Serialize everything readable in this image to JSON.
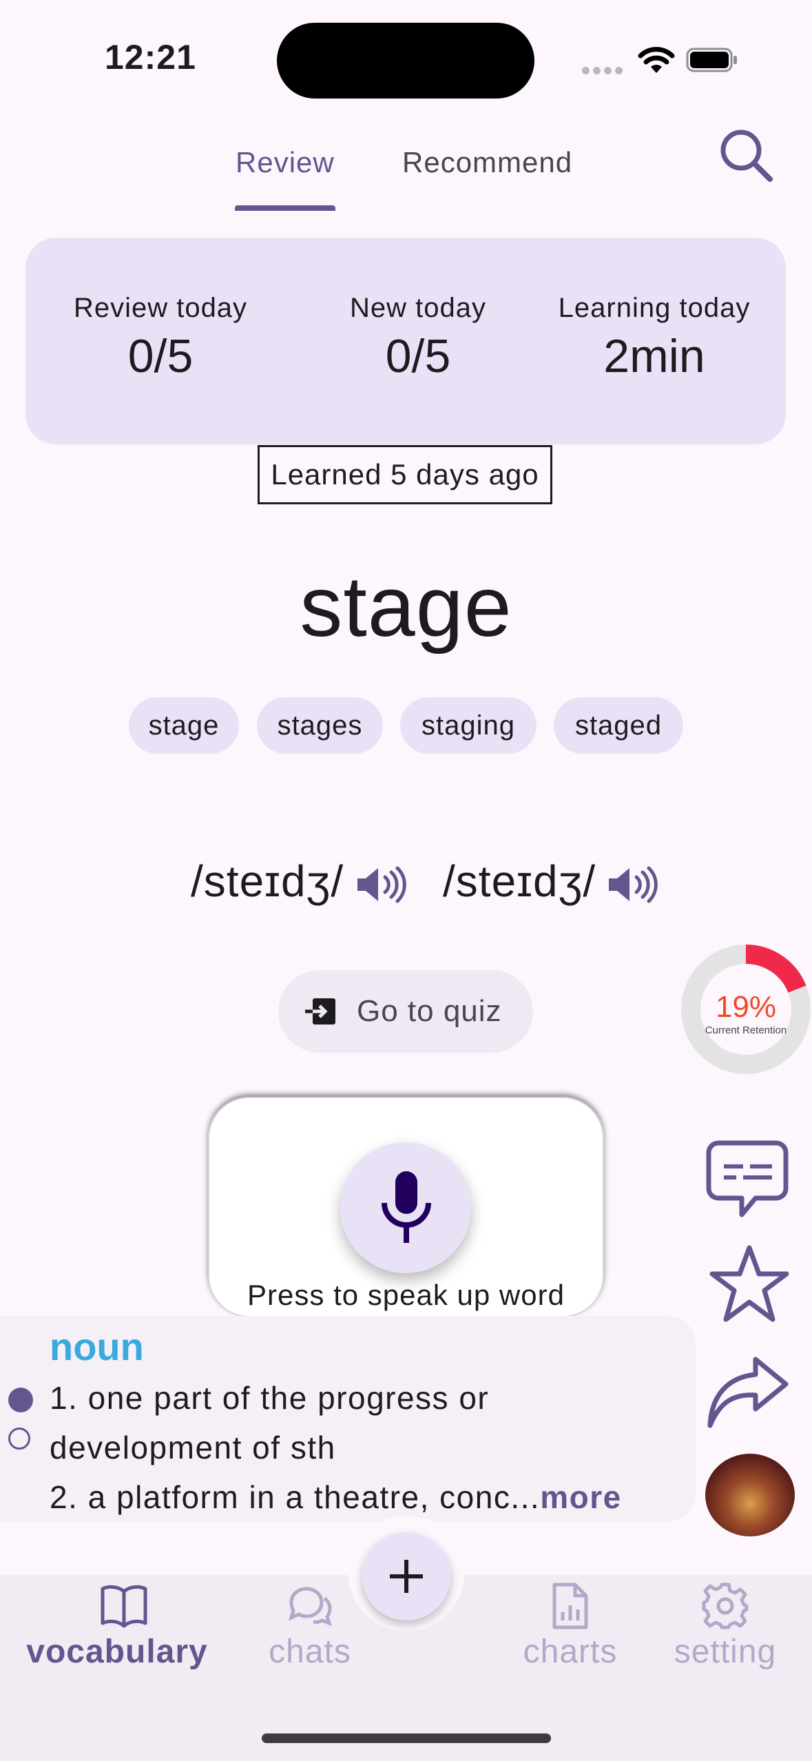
{
  "status_bar": {
    "time": "12:21"
  },
  "tabs": [
    {
      "label": "Review",
      "active": true
    },
    {
      "label": "Recommend",
      "active": false
    }
  ],
  "stats": [
    {
      "label": "Review today",
      "value": "0/5"
    },
    {
      "label": "New today",
      "value": "0/5"
    },
    {
      "label": "Learning today",
      "value": "2min"
    }
  ],
  "learned_badge": "Learned 5 days ago",
  "word": "stage",
  "forms": [
    "stage",
    "stages",
    "staging",
    "staged"
  ],
  "pronunciations": [
    "/steɪdʒ/",
    "/steɪdʒ/"
  ],
  "quiz_button": "Go to quiz",
  "retention": {
    "percent": "19%",
    "label": "Current Retention",
    "fraction": 0.19
  },
  "speak_hint": "Press to speak up word",
  "definition": {
    "part_of_speech": "noun",
    "line1": "1. one part of the progress or",
    "line2": "development of sth",
    "line3": "2. a platform in a theatre, conc...",
    "more": "more"
  },
  "bottom_nav": [
    {
      "label": "vocabulary",
      "icon": "book-icon",
      "active": true
    },
    {
      "label": "chats",
      "icon": "chat-bubbles-icon",
      "active": false
    },
    {
      "label": "charts",
      "icon": "chart-file-icon",
      "active": false
    },
    {
      "label": "setting",
      "icon": "gear-icon",
      "active": false
    }
  ],
  "colors": {
    "primary": "#65558f",
    "surface": "#fdf7fd",
    "card": "#e9e2f6",
    "pos": "#3aa9e0",
    "retention": "#f0284a",
    "inactive": "#b3a8c9"
  }
}
